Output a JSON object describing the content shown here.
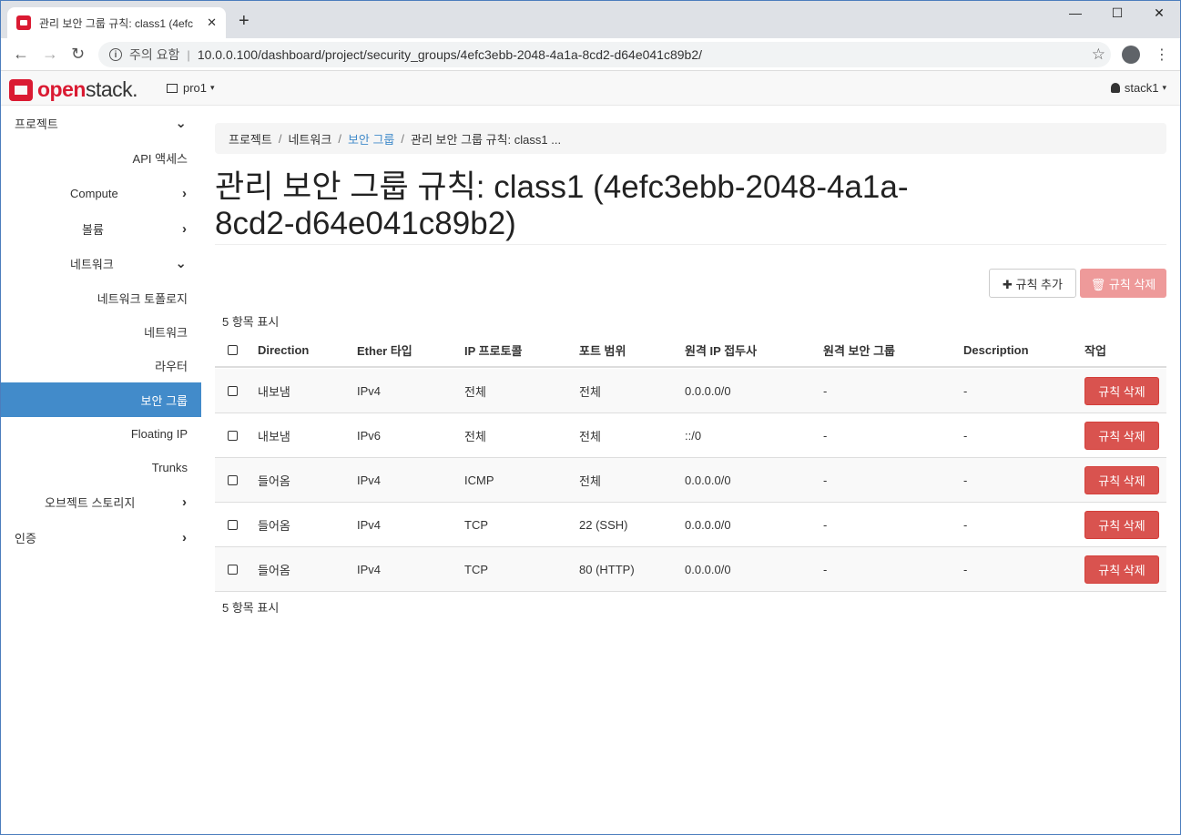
{
  "browser": {
    "tab_title": "관리 보안 그룹 규칙: class1 (4efc",
    "tab_close": "✕",
    "new_tab": "+",
    "window_minimize": "—",
    "window_maximize": "☐",
    "window_close": "✕",
    "security_label": "주의 요함",
    "url_sep": "|",
    "url": "10.0.0.100/dashboard/project/security_groups/4efc3ebb-2048-4a1a-8cd2-d64e041c89b2/",
    "back": "←",
    "forward": "→",
    "reload": "↻",
    "star": "☆",
    "menu": "⋮"
  },
  "header": {
    "logo_brand": "open",
    "logo_brand2": "stack.",
    "project": "pro1",
    "user": "stack1",
    "caret": "▾"
  },
  "sidebar": {
    "items": [
      {
        "label": "프로젝트",
        "chevron": "⌄"
      },
      {
        "label": "API 액세스"
      },
      {
        "label": "Compute",
        "chevron": "›"
      },
      {
        "label": "볼륨",
        "chevron": "›"
      },
      {
        "label": "네트워크",
        "chevron": "⌄"
      },
      {
        "label": "네트워크 토폴로지"
      },
      {
        "label": "네트워크"
      },
      {
        "label": "라우터"
      },
      {
        "label": "보안 그룹"
      },
      {
        "label": "Floating IP"
      },
      {
        "label": "Trunks"
      },
      {
        "label": "오브젝트 스토리지",
        "chevron": "›"
      },
      {
        "label": "인증",
        "chevron": "›"
      }
    ]
  },
  "breadcrumb": {
    "items": [
      "프로젝트",
      "네트워크",
      "보안 그룹",
      "관리 보안 그룹 규칙: class1 ..."
    ],
    "sep": "/"
  },
  "page": {
    "title": "관리 보안 그룹 규칙: class1 (4efc3ebb-2048-4a1a-8cd2-d64e041c89b2)",
    "add_rule": "✚ 규칙 추가",
    "delete_rules": "🗑 규칙 삭제",
    "count_top": "5 항목 표시",
    "count_bottom": "5 항목 표시"
  },
  "table": {
    "columns": [
      "Direction",
      "Ether 타입",
      "IP 프로토콜",
      "포트 범위",
      "원격 IP 접두사",
      "원격 보안 그룹",
      "Description",
      "작업"
    ],
    "rows": [
      {
        "direction": "내보냄",
        "ether": "IPv4",
        "protocol": "전체",
        "port": "전체",
        "prefix": "0.0.0.0/0",
        "group": "-",
        "desc": "-",
        "action": "규칙 삭제"
      },
      {
        "direction": "내보냄",
        "ether": "IPv6",
        "protocol": "전체",
        "port": "전체",
        "prefix": "::/0",
        "group": "-",
        "desc": "-",
        "action": "규칙 삭제"
      },
      {
        "direction": "들어옴",
        "ether": "IPv4",
        "protocol": "ICMP",
        "port": "전체",
        "prefix": "0.0.0.0/0",
        "group": "-",
        "desc": "-",
        "action": "규칙 삭제"
      },
      {
        "direction": "들어옴",
        "ether": "IPv4",
        "protocol": "TCP",
        "port": "22 (SSH)",
        "prefix": "0.0.0.0/0",
        "group": "-",
        "desc": "-",
        "action": "규칙 삭제"
      },
      {
        "direction": "들어옴",
        "ether": "IPv4",
        "protocol": "TCP",
        "port": "80 (HTTP)",
        "prefix": "0.0.0.0/0",
        "group": "-",
        "desc": "-",
        "action": "규칙 삭제"
      }
    ]
  },
  "colors": {
    "brand": "#da1a32",
    "active_nav": "#428bca",
    "danger": "#d9534f"
  }
}
